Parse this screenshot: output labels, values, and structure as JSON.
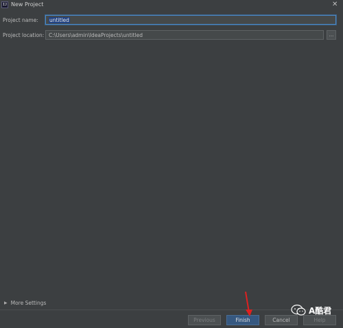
{
  "window": {
    "title": "New Project",
    "icon_name": "intellij-app-icon",
    "icon_letters": "IJ"
  },
  "form": {
    "project_name_label": "Project name:",
    "project_name_value": "untitled",
    "project_location_label": "Project location:",
    "project_location_value": "C:\\Users\\admin\\IdeaProjects\\untitled",
    "browse_label": "..."
  },
  "more_settings": {
    "label": "More Settings",
    "expanded": false
  },
  "buttons": {
    "previous": "Previous",
    "finish": "Finish",
    "cancel": "Cancel",
    "help": "Help"
  },
  "watermark": {
    "text": "A酷君",
    "icon_name": "wechat-icon"
  },
  "colors": {
    "background": "#3c3f41",
    "focus_border": "#4a88c7",
    "primary_button": "#365880",
    "annotation_arrow": "#e02020"
  }
}
